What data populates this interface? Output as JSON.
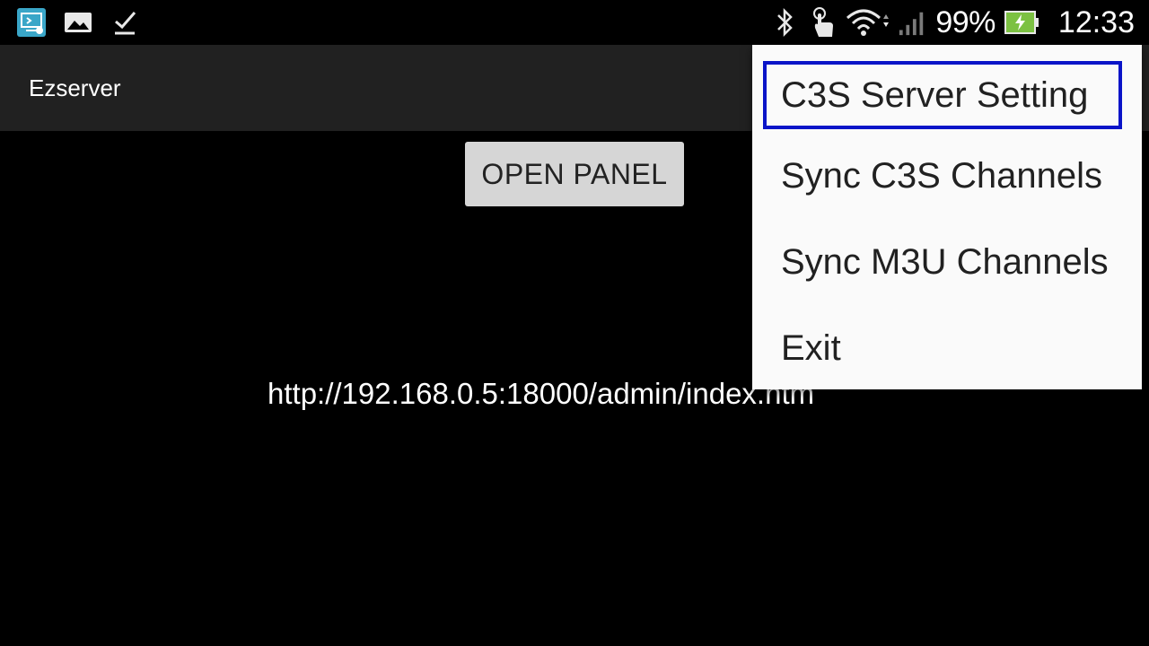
{
  "status_bar": {
    "left_icons": [
      "remote-desktop-icon",
      "image-icon",
      "download-done-icon"
    ],
    "right_icons": [
      "bluetooth-icon",
      "touch-icon",
      "wifi-icon",
      "signal-icon",
      "battery-charging-icon"
    ],
    "battery_percent": "99%",
    "time": "12:33",
    "colors": {
      "background": "#000000",
      "text": "#ffffff",
      "battery_fill": "#7cc142",
      "app_icon": "#3aa6c8"
    }
  },
  "app_bar": {
    "title": "Ezserver",
    "background": "#212121"
  },
  "content": {
    "open_panel_label": "OPEN PANEL",
    "url": "http://192.168.0.5:18000/admin/index.htm"
  },
  "menu": {
    "items": [
      {
        "label": "C3S Server Setting",
        "focused": true
      },
      {
        "label": "Sync C3S Channels",
        "focused": false
      },
      {
        "label": "Sync M3U Channels",
        "focused": false
      },
      {
        "label": "Exit",
        "focused": false
      }
    ],
    "background": "#fafafa",
    "focus_color": "#0a14c8"
  }
}
